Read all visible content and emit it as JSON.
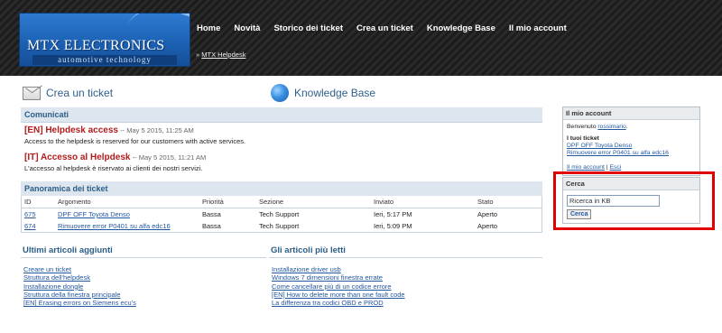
{
  "header": {
    "logo_title": "MTX ELECTRONICS",
    "logo_subtitle": "automotive technology",
    "nav": [
      "Home",
      "Novità",
      "Storico dei ticket",
      "Crea un ticket",
      "Knowledge Base",
      "Il mio account"
    ],
    "breadcrumb_sep": "»",
    "breadcrumb": "MTX Helpdesk"
  },
  "quick_links": {
    "new_ticket": "Crea un ticket",
    "kb": "Knowledge Base"
  },
  "comunicati": {
    "heading": "Comunicati",
    "items": [
      {
        "title": "[EN] Helpdesk access",
        "date": "-- May 5 2015, 11:25 AM",
        "body": "Access to the helpdesk is reserved for our customers with active services."
      },
      {
        "title": "[IT] Accesso al Helpdesk",
        "date": "-- May 5 2015, 11:21 AM",
        "body": "L'accesso al helpdesk è riservato ai clienti dei nostri servizi."
      }
    ]
  },
  "tickets": {
    "heading": "Panoramica dei ticket",
    "columns": [
      "ID",
      "Argomento",
      "Priorità",
      "Sezione",
      "Inviato",
      "Stato"
    ],
    "rows": [
      [
        "675",
        "DPF OFF Toyota Denso",
        "Bassa",
        "Tech Support",
        "Ieri, 5:17 PM",
        "Aperto"
      ],
      [
        "674",
        "Rimuovere error P0401 su alfa edc16",
        "Bassa",
        "Tech Support",
        "Ieri, 5:09 PM",
        "Aperto"
      ]
    ]
  },
  "latest_articles": {
    "heading": "Ultimi articoli aggiunti",
    "items": [
      "Creare un ticket",
      "Struttura dell'helpdesk",
      "Installazione dongle",
      "Struttura della finestra principale",
      "[EN] Erasing errors on Siemens ecu's"
    ]
  },
  "most_read": {
    "heading": "Gli articoli più letti",
    "items": [
      "Installazione driver usb",
      "Windows 7 dimensioni finestra errate",
      "Come cancellare più di un codice errore",
      "[EN] How to delete more than one fault code",
      "La differenza tra codici OBD e PROD"
    ]
  },
  "account": {
    "heading": "Il mio account",
    "welcome": "Benvenuto",
    "user": "rossimario",
    "tickets_label": "I tuoi ticket",
    "tickets": [
      "DPF OFF Toyota Denso",
      "Rimuovere error P0401 su alfa edc16"
    ],
    "my_account": "Il mio account",
    "sep": "|",
    "logout": "Esci"
  },
  "search": {
    "heading": "Cerca",
    "value": "Ricerca in KB",
    "button": "Cerca"
  },
  "colors": {
    "highlight": "#e00000",
    "link": "#2357a0",
    "news_title": "#b41b1b"
  }
}
